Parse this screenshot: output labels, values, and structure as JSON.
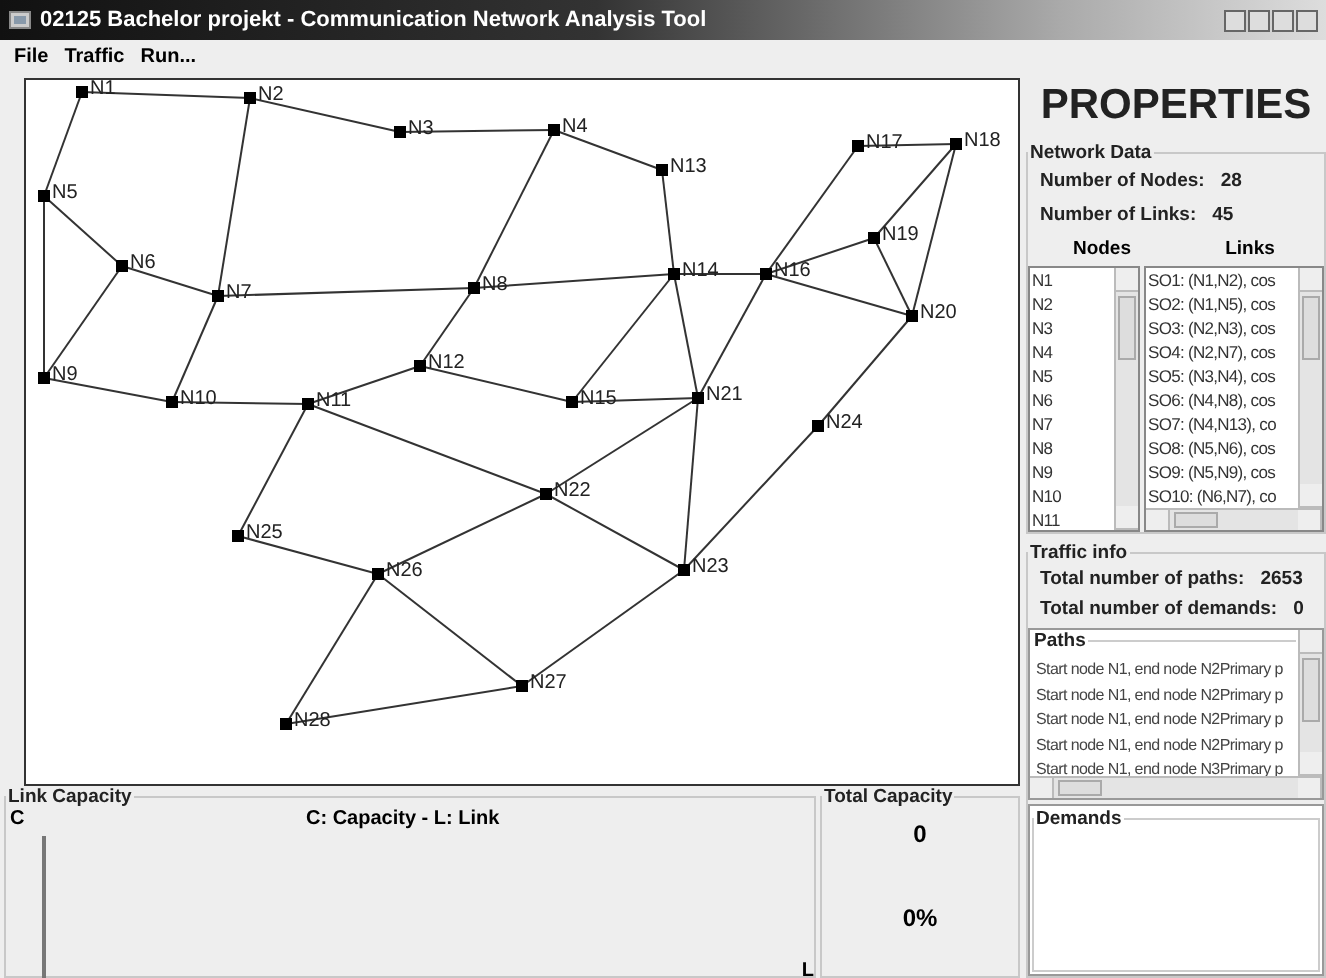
{
  "window": {
    "title": "02125 Bachelor projekt - Communication Network Analysis Tool"
  },
  "menu": [
    "File",
    "Traffic",
    "Run..."
  ],
  "network": {
    "nodes": [
      "N1",
      "N2",
      "N3",
      "N4",
      "N5",
      "N6",
      "N7",
      "N8",
      "N9",
      "N10",
      "N11",
      "N12",
      "N13",
      "N14",
      "N15",
      "N16",
      "N17",
      "N18",
      "N19",
      "N20",
      "N21",
      "N22",
      "N23",
      "N24",
      "N25",
      "N26",
      "N27",
      "N28"
    ]
  },
  "properties": {
    "title": "PROPERTIES",
    "network_data": {
      "title": "Network Data",
      "fields": [
        {
          "label": "Number of Nodes:",
          "value": "28"
        },
        {
          "label": "Number of Links:",
          "value": "45"
        }
      ],
      "nodes_header": "Nodes",
      "links_header": "Links",
      "nodes_list": [
        "N1",
        "N2",
        "N3",
        "N4",
        "N5",
        "N6",
        "N7",
        "N8",
        "N9",
        "N10",
        "N11"
      ],
      "links_list": [
        "SO1: (N1,N2), cos",
        "SO2: (N1,N5), cos",
        "SO3: (N2,N3), cos",
        "SO4: (N2,N7), cos",
        "SO5: (N3,N4), cos",
        "SO6: (N4,N8), cos",
        "SO7: (N4,N13), co",
        "SO8: (N5,N6), cos",
        "SO9: (N5,N9), cos",
        "SO10: (N6,N7), co"
      ]
    },
    "traffic_info": {
      "title": "Traffic info",
      "fields": [
        {
          "label": "Total number of paths:",
          "value": "2653"
        },
        {
          "label": "Total number of demands:",
          "value": "0"
        }
      ],
      "paths": {
        "title": "Paths",
        "items": [
          "Start node N1, end node N2Primary p",
          "Start node N1, end node N2Primary p",
          "Start node N1, end node N2Primary p",
          "Start node N1, end node N2Primary p",
          "Start node N1, end node N3Primary p"
        ]
      },
      "demands": {
        "title": "Demands"
      }
    }
  },
  "link_capacity": {
    "title": "Link Capacity",
    "y_axis": "C",
    "x_axis": "L",
    "legend": "C: Capacity - L: Link"
  },
  "total_capacity": {
    "title": "Total Capacity",
    "value": "0",
    "percent": "0%"
  }
}
